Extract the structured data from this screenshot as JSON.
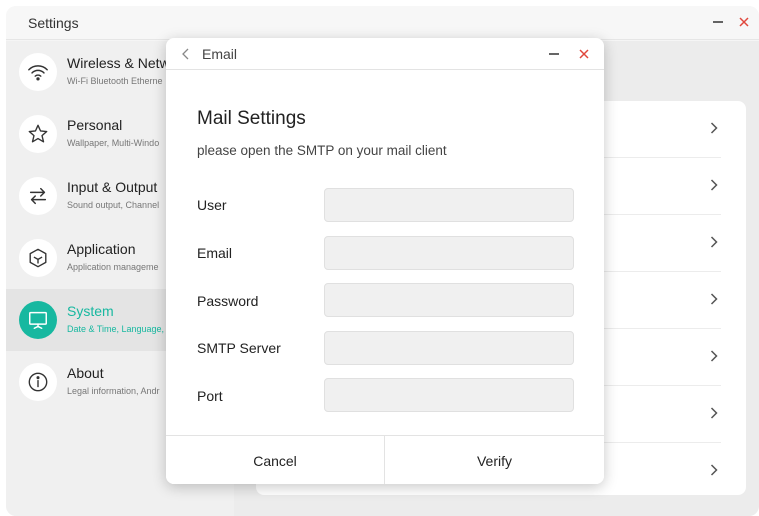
{
  "window": {
    "title": "Settings"
  },
  "sidebar": {
    "items": [
      {
        "title": "Wireless & Netw",
        "subtitle": "Wi-Fi Bluetooth Etherne",
        "icon": "wifi-icon"
      },
      {
        "title": "Personal",
        "subtitle": "Wallpaper, Multi-Windo",
        "icon": "star-icon"
      },
      {
        "title": "Input & Output",
        "subtitle": "Sound output, Channel",
        "icon": "swap-arrows-icon"
      },
      {
        "title": "Application",
        "subtitle": "Application manageme",
        "icon": "cube-icon"
      },
      {
        "title": "System",
        "subtitle": "Date & Time, Language,",
        "icon": "monitor-icon",
        "active": true
      },
      {
        "title": "About",
        "subtitle": "Legal information, Andr",
        "icon": "info-icon"
      }
    ]
  },
  "dialog": {
    "title": "Email",
    "heading": "Mail Settings",
    "hint": "please open the SMTP on your mail client",
    "fields": [
      {
        "label": "User",
        "value": ""
      },
      {
        "label": "Email",
        "value": ""
      },
      {
        "label": "Password",
        "value": ""
      },
      {
        "label": "SMTP Server",
        "value": ""
      },
      {
        "label": "Port",
        "value": ""
      }
    ],
    "cancel_label": "Cancel",
    "verify_label": "Verify"
  },
  "colors": {
    "accent": "#17b8a0",
    "close": "#e0483d"
  }
}
